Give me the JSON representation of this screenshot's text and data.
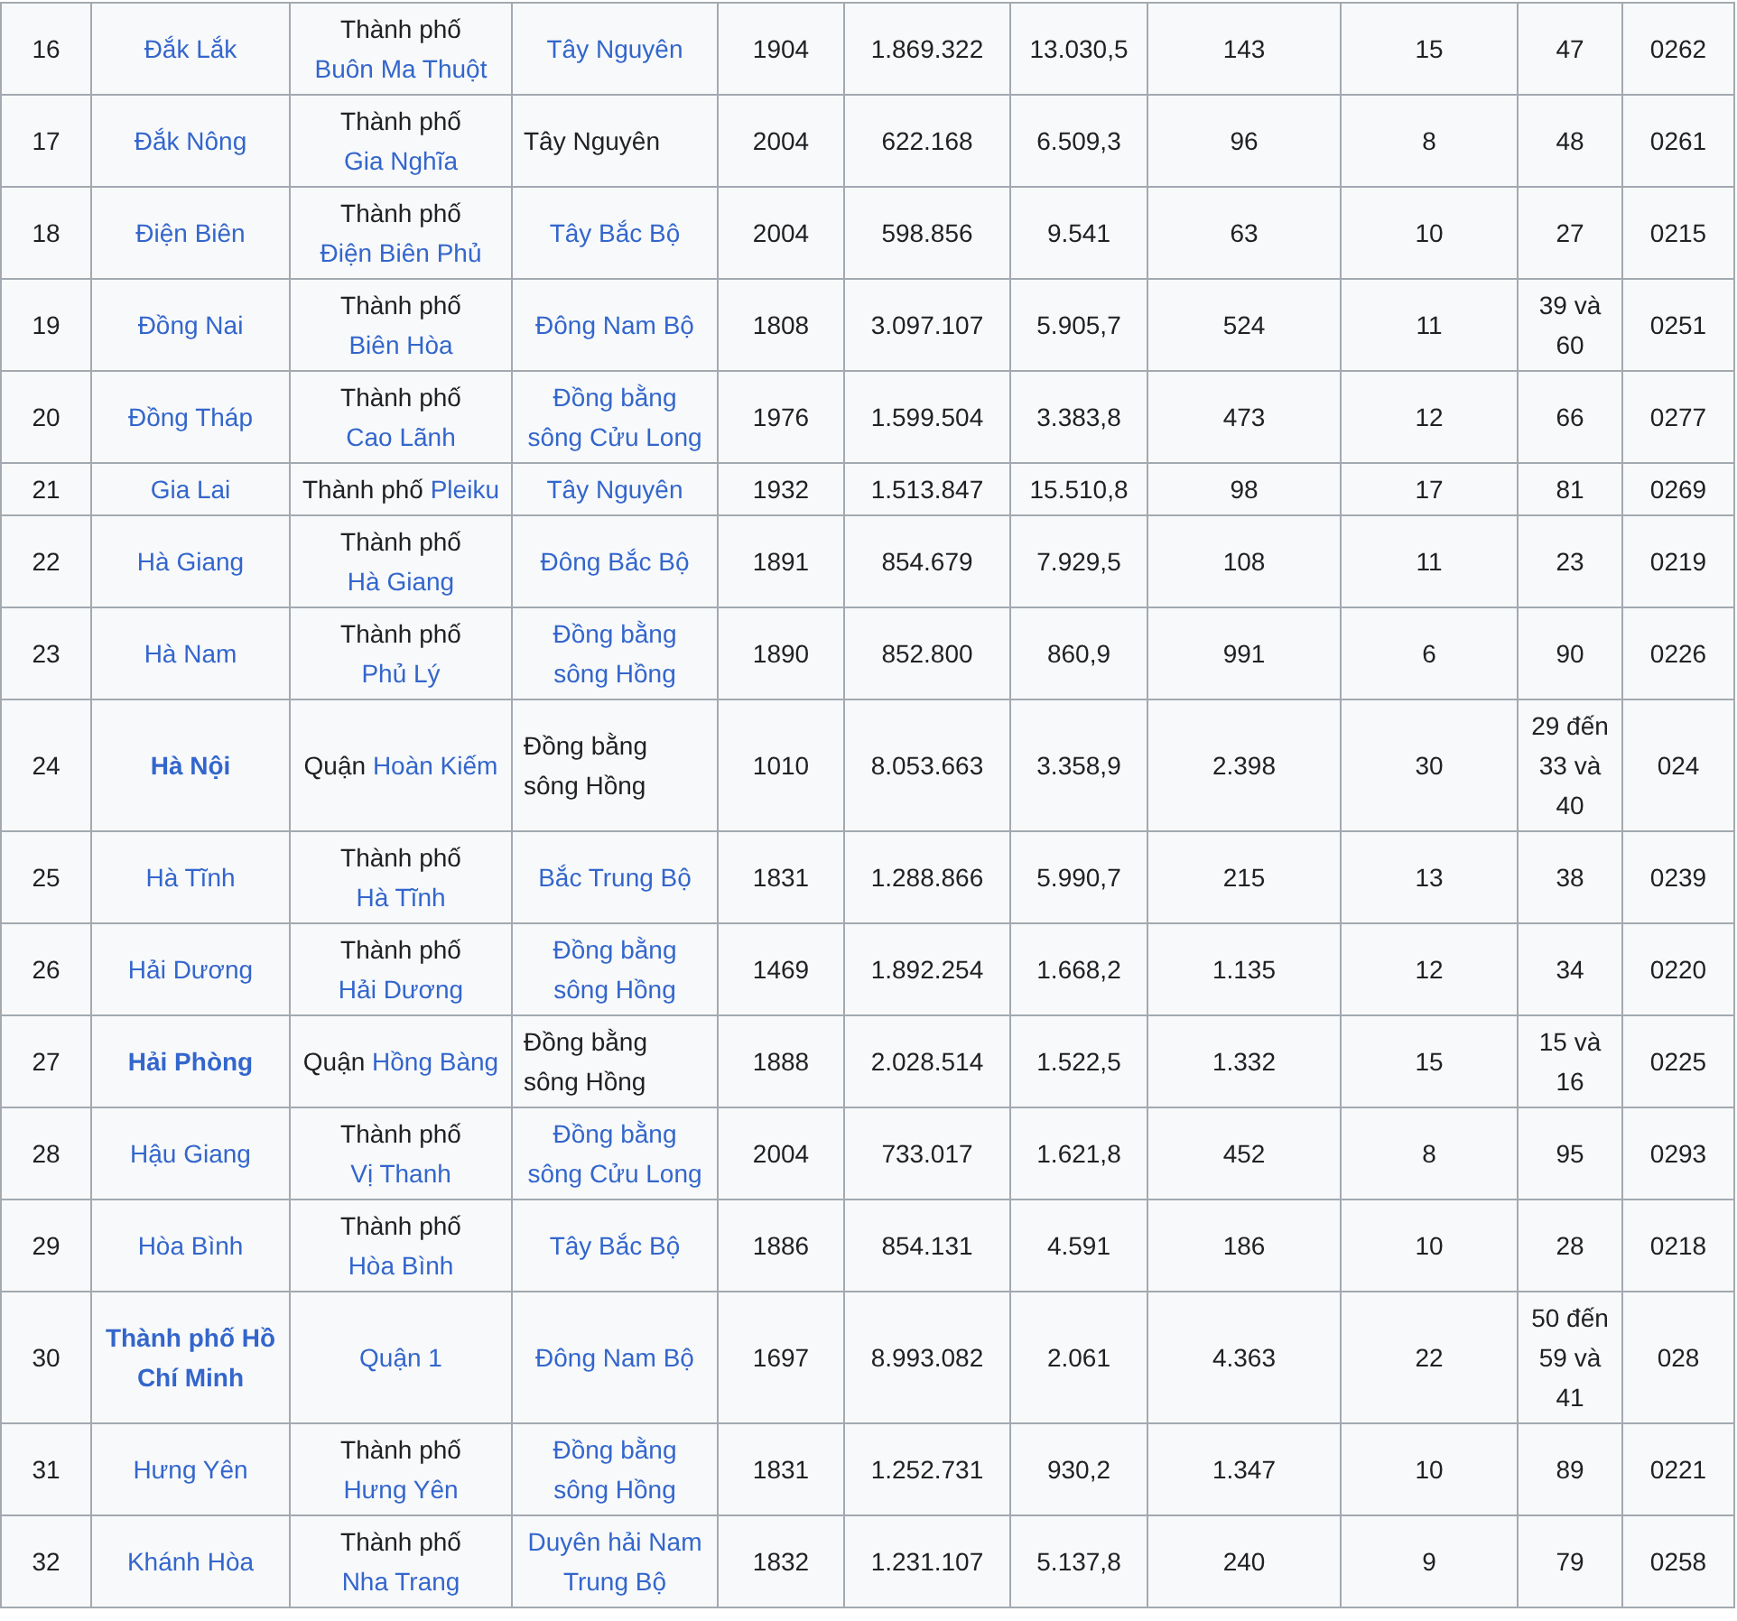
{
  "table": {
    "rows": [
      {
        "number": "16",
        "province": {
          "text": "Đắk Lắk",
          "bold": false
        },
        "capital": {
          "prefix": "Thành phố",
          "link": "Buôn Ma Thuột"
        },
        "region": {
          "text": "Tây Nguyên",
          "link": true
        },
        "founded": "1904",
        "population": "1.869.322",
        "area": "13.030,5",
        "density": "143",
        "districts": "15",
        "plate": "47",
        "area_code": "0262"
      },
      {
        "number": "17",
        "province": {
          "text": "Đắk Nông",
          "bold": false
        },
        "capital": {
          "prefix": "Thành phố",
          "link": "Gia Nghĩa"
        },
        "region": {
          "text": "Tây Nguyên",
          "link": false
        },
        "founded": "2004",
        "population": "622.168",
        "area": "6.509,3",
        "density": "96",
        "districts": "8",
        "plate": "48",
        "area_code": "0261"
      },
      {
        "number": "18",
        "province": {
          "text": "Điện Biên",
          "bold": false
        },
        "capital": {
          "prefix": "Thành phố",
          "link": "Điện Biên Phủ"
        },
        "region": {
          "text": "Tây Bắc Bộ",
          "link": true
        },
        "founded": "2004",
        "population": "598.856",
        "area": "9.541",
        "density": "63",
        "districts": "10",
        "plate": "27",
        "area_code": "0215"
      },
      {
        "number": "19",
        "province": {
          "text": "Đồng Nai",
          "bold": false
        },
        "capital": {
          "prefix": "Thành phố",
          "link": "Biên Hòa"
        },
        "region": {
          "text": "Đông Nam Bộ",
          "link": true
        },
        "founded": "1808",
        "population": "3.097.107",
        "area": "5.905,7",
        "density": "524",
        "districts": "11",
        "plate": "39 và 60",
        "area_code": "0251"
      },
      {
        "number": "20",
        "province": {
          "text": "Đồng Tháp",
          "bold": false
        },
        "capital": {
          "prefix": "Thành phố",
          "link": "Cao Lãnh"
        },
        "region": {
          "text": "Đồng bằng sông Cửu Long",
          "link": true
        },
        "founded": "1976",
        "population": "1.599.504",
        "area": "3.383,8",
        "density": "473",
        "districts": "12",
        "plate": "66",
        "area_code": "0277"
      },
      {
        "number": "21",
        "province": {
          "text": "Gia Lai",
          "bold": false
        },
        "capital": {
          "prefix": "Thành phố",
          "link": "Pleiku"
        },
        "region": {
          "text": "Tây Nguyên",
          "link": true
        },
        "founded": "1932",
        "population": "1.513.847",
        "area": "15.510,8",
        "density": "98",
        "districts": "17",
        "plate": "81",
        "area_code": "0269"
      },
      {
        "number": "22",
        "province": {
          "text": "Hà Giang",
          "bold": false
        },
        "capital": {
          "prefix": "Thành phố",
          "link": "Hà Giang"
        },
        "region": {
          "text": "Đông Bắc Bộ",
          "link": true
        },
        "founded": "1891",
        "population": "854.679",
        "area": "7.929,5",
        "density": "108",
        "districts": "11",
        "plate": "23",
        "area_code": "0219"
      },
      {
        "number": "23",
        "province": {
          "text": "Hà Nam",
          "bold": false
        },
        "capital": {
          "prefix": "Thành phố",
          "link": "Phủ Lý"
        },
        "region": {
          "text": "Đồng bằng sông Hồng",
          "link": true
        },
        "founded": "1890",
        "population": "852.800",
        "area": "860,9",
        "density": "991",
        "districts": "6",
        "plate": "90",
        "area_code": "0226"
      },
      {
        "number": "24",
        "province": {
          "text": "Hà Nội",
          "bold": true
        },
        "capital": {
          "prefix": "Quận",
          "link": "Hoàn Kiếm"
        },
        "region": {
          "text": "Đồng bằng sông Hồng",
          "link": false
        },
        "founded": "1010",
        "population": "8.053.663",
        "area": "3.358,9",
        "density": "2.398",
        "districts": "30",
        "plate": "29 đến 33 và 40",
        "area_code": "024"
      },
      {
        "number": "25",
        "province": {
          "text": "Hà Tĩnh",
          "bold": false
        },
        "capital": {
          "prefix": "Thành phố",
          "link": "Hà Tĩnh"
        },
        "region": {
          "text": "Bắc Trung Bộ",
          "link": true
        },
        "founded": "1831",
        "population": "1.288.866",
        "area": "5.990,7",
        "density": "215",
        "districts": "13",
        "plate": "38",
        "area_code": "0239"
      },
      {
        "number": "26",
        "province": {
          "text": "Hải Dương",
          "bold": false
        },
        "capital": {
          "prefix": "Thành phố",
          "link": "Hải Dương"
        },
        "region": {
          "text": "Đồng bằng sông Hồng",
          "link": true
        },
        "founded": "1469",
        "population": "1.892.254",
        "area": "1.668,2",
        "density": "1.135",
        "districts": "12",
        "plate": "34",
        "area_code": "0220"
      },
      {
        "number": "27",
        "province": {
          "text": "Hải Phòng",
          "bold": true
        },
        "capital": {
          "prefix": "Quận",
          "link": "Hồng Bàng"
        },
        "region": {
          "text": "Đồng bằng sông Hồng",
          "link": false
        },
        "founded": "1888",
        "population": "2.028.514",
        "area": "1.522,5",
        "density": "1.332",
        "districts": "15",
        "plate": "15 và 16",
        "area_code": "0225"
      },
      {
        "number": "28",
        "province": {
          "text": "Hậu Giang",
          "bold": false
        },
        "capital": {
          "prefix": "Thành phố",
          "link": "Vị Thanh"
        },
        "region": {
          "text": "Đồng bằng sông Cửu Long",
          "link": true
        },
        "founded": "2004",
        "population": "733.017",
        "area": "1.621,8",
        "density": "452",
        "districts": "8",
        "plate": "95",
        "area_code": "0293"
      },
      {
        "number": "29",
        "province": {
          "text": "Hòa Bình",
          "bold": false
        },
        "capital": {
          "prefix": "Thành phố",
          "link": "Hòa Bình"
        },
        "region": {
          "text": "Tây Bắc Bộ",
          "link": true
        },
        "founded": "1886",
        "population": "854.131",
        "area": "4.591",
        "density": "186",
        "districts": "10",
        "plate": "28",
        "area_code": "0218"
      },
      {
        "number": "30",
        "province": {
          "text": "Thành phố Hồ Chí Minh",
          "bold": true
        },
        "capital": {
          "link": "Quận 1"
        },
        "region": {
          "text": "Đông Nam Bộ",
          "link": true
        },
        "founded": "1697",
        "population": "8.993.082",
        "area": "2.061",
        "density": "4.363",
        "districts": "22",
        "plate": "50 đến 59 và 41",
        "area_code": "028"
      },
      {
        "number": "31",
        "province": {
          "text": "Hưng Yên",
          "bold": false
        },
        "capital": {
          "prefix": "Thành phố",
          "link": "Hưng Yên"
        },
        "region": {
          "text": "Đồng bằng sông Hồng",
          "link": true
        },
        "founded": "1831",
        "population": "1.252.731",
        "area": "930,2",
        "density": "1.347",
        "districts": "10",
        "plate": "89",
        "area_code": "0221"
      },
      {
        "number": "32",
        "province": {
          "text": "Khánh Hòa",
          "bold": false
        },
        "capital": {
          "prefix": "Thành phố",
          "link": "Nha Trang"
        },
        "region": {
          "text": "Duyên hải Nam Trung Bộ",
          "link": true
        },
        "founded": "1832",
        "population": "1.231.107",
        "area": "5.137,8",
        "density": "240",
        "districts": "9",
        "plate": "79",
        "area_code": "0258"
      }
    ]
  }
}
